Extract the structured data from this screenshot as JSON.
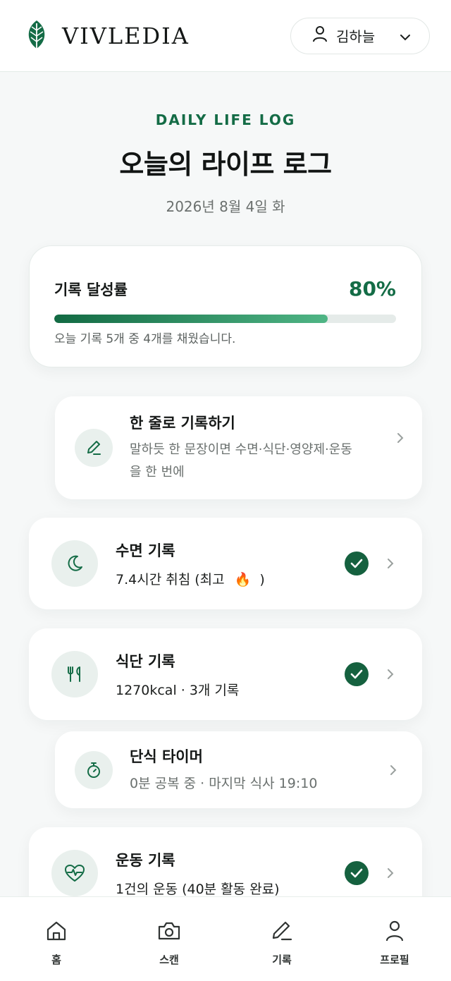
{
  "header": {
    "brand": "VIVLEDIA",
    "user_name": "김하늘"
  },
  "hero": {
    "eyebrow": "DAILY LIFE LOG",
    "title": "오늘의 라이프 로그",
    "date": "2026년 8월 4일 화"
  },
  "progress": {
    "label": "기록 달성률",
    "value_text": "80%",
    "fraction": 0.8,
    "note": "오늘 기록 5개 중 4개를 채웠습니다."
  },
  "quick_log": {
    "title": "한 줄로 기록하기",
    "desc_line1": "말하듯 한 문장이면 수면·식단·영양제·운동",
    "desc_line2": "을 한 번에"
  },
  "sleep": {
    "title": "수면 기록",
    "summary": "7.4시간 취침 (최고",
    "emoji": "🔥",
    "summary_end": ")"
  },
  "meal": {
    "title": "식단 기록",
    "summary": "1270kcal · 3개 기록"
  },
  "fasting": {
    "title": "단식 타이머",
    "summary": "0분 공복 중 · 마지막 식사 19:10"
  },
  "exercise": {
    "title": "운동 기록",
    "summary": "1건의 운동 (40분 활동 완료)"
  },
  "nav": {
    "home": "홈",
    "scan": "스캔",
    "log": "기록",
    "profile": "프로필"
  },
  "colors": {
    "accent": "#146c46",
    "check_bg": "#15613f",
    "icon_bg": "#e9f0ed"
  },
  "icons": {
    "brand": "leaf-icon",
    "user": "user-icon",
    "quick_log": "pencil-icon",
    "sleep": "moon-icon",
    "meal": "utensils-icon",
    "fasting": "stopwatch-icon",
    "exercise": "heart-pulse-icon"
  }
}
